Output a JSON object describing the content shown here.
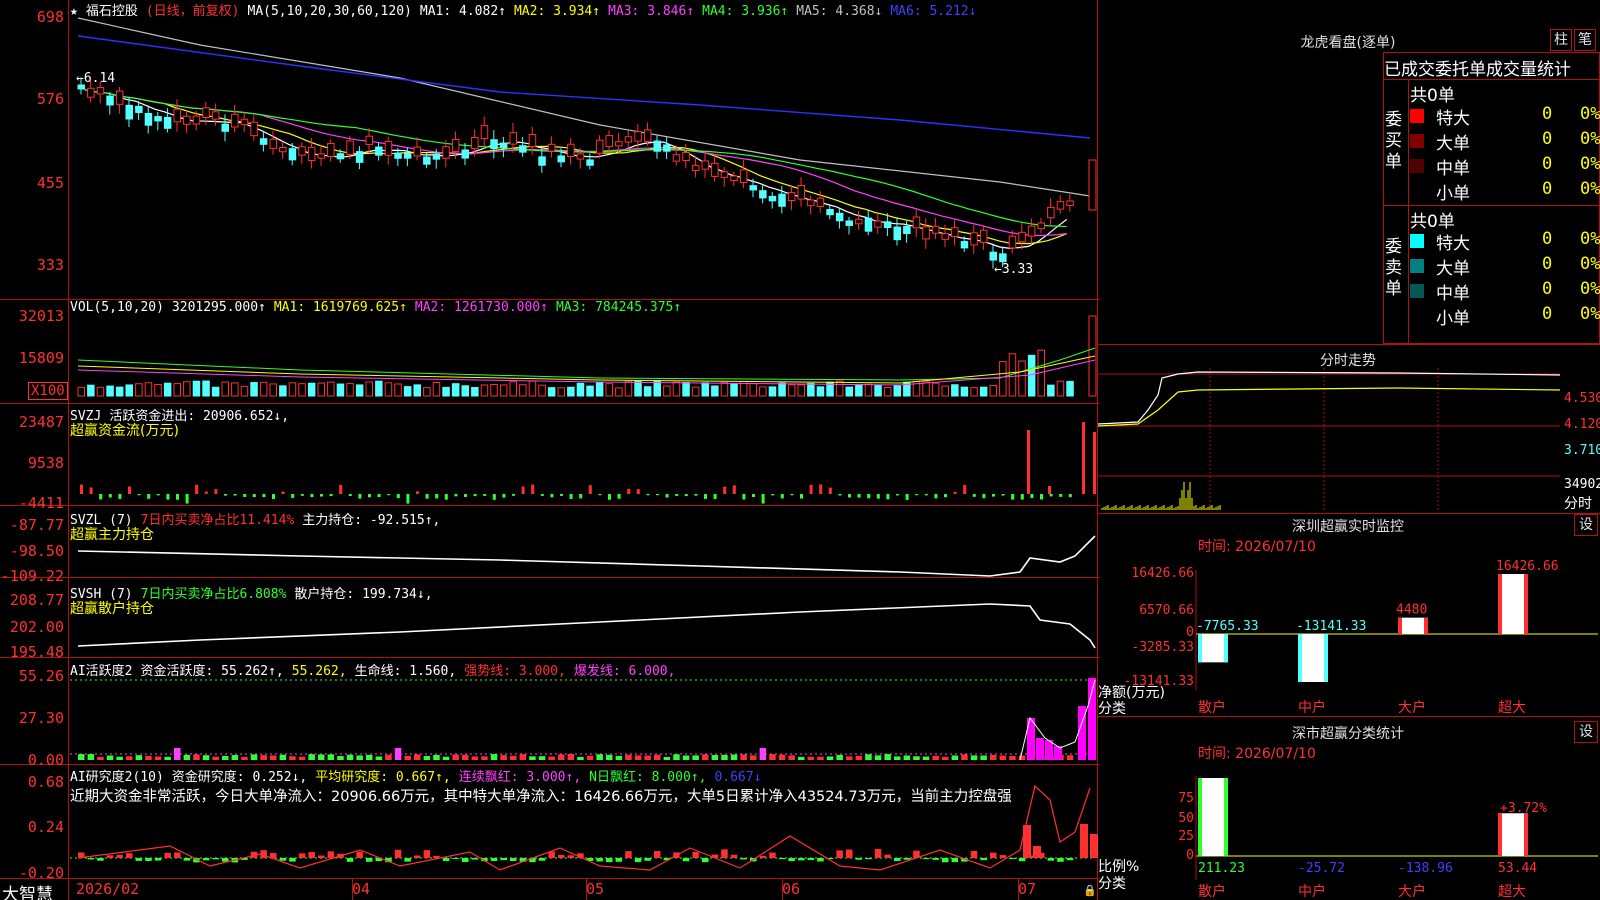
{
  "main": {
    "stock_name": "福石控股",
    "period": "(日线，前复权)",
    "ma_prefix": "MA(5,10,20,30,60,120)",
    "ma": [
      {
        "label": "MA1: 4.082↑",
        "color": "#ffffff"
      },
      {
        "label": "MA2: 3.934↑",
        "color": "#ffff00"
      },
      {
        "label": "MA3: 3.846↑",
        "color": "#ff40ff"
      },
      {
        "label": "MA4: 3.936↑",
        "color": "#30ff30"
      },
      {
        "label": "MA5: 4.368↓",
        "color": "#c0c0c0"
      },
      {
        "label": "MA6: 5.212↓",
        "color": "#4040ff"
      }
    ],
    "yticks": [
      "698",
      "576",
      "455",
      "333"
    ],
    "high_mark": "6.14",
    "low_mark": "3.33"
  },
  "volume": {
    "legend_prefix": "VOL(5,10,20)",
    "value": "3201295.000↑",
    "ma1": "MA1: 1619769.625↑",
    "ma2": "MA2: 1261730.000↑",
    "ma3": "MA3: 784245.375↑",
    "yticks": [
      "32013",
      "15809"
    ],
    "unit": "X100"
  },
  "svzj": {
    "name": "SVZJ",
    "line": "活跃资金进出: 20906.652↓,",
    "sub": "超赢资金流(万元)",
    "yticks": [
      "23487",
      "9538",
      "-4411"
    ]
  },
  "svzl": {
    "name": "SVZL (7)",
    "ratio": "7日内买卖净占比11.414%",
    "line": "主力持仓: -92.515↑,",
    "sub": "超赢主力持仓",
    "yticks": [
      "-87.77",
      "-98.50",
      "-109.22"
    ]
  },
  "svsh": {
    "name": "SVSH (7)",
    "ratio": "7日内买卖净占比6.808%",
    "line": "散户持仓: 199.734↓,",
    "sub": "超赢散户持仓",
    "yticks": [
      "208.77",
      "202.00",
      "195.48"
    ]
  },
  "ai_active": {
    "name": "AI活跃度2",
    "a": "资金活跃度: 55.262↑,",
    "b": "55.262,",
    "c": "生命线: 1.560,",
    "d": "强势线: 3.000,",
    "e": "爆发线: 6.000,",
    "yticks": [
      "55.26",
      "27.30",
      "0.00"
    ]
  },
  "ai_research": {
    "name": "AI研究度2(10)",
    "a": "资金研究度: 0.252↓,",
    "b": "平均研究度: 0.667↑,",
    "c": "连续飘红: 3.000↑,",
    "d": "N日飘红: 8.000↑,",
    "e": "0.667↓",
    "summary": "近期大资金非常活跃，今日大单净流入：20906.66万元，其中特大单净流入：16426.66万元，大单5日累计净入43524.73万元，当前主力控盘强",
    "yticks": [
      "0.68",
      "0.24",
      "-0.20"
    ]
  },
  "xaxis": {
    "brand": "大智慧",
    "ticks": [
      "2026/02",
      "04",
      "05",
      "06",
      "07"
    ]
  },
  "right": {
    "lhb_title": "龙虎看盘(逐单)",
    "btn_bar": "柱",
    "btn_pen": "笔",
    "stats_title": "已成交委托单成交量统计",
    "buy_label": "委买单",
    "sell_label": "委卖单",
    "buy_total": "共0单",
    "sell_total": "共0单",
    "buy_rows": [
      {
        "name": "特大",
        "n": "0",
        "p": "0%",
        "color": "#ff0000"
      },
      {
        "name": "大单",
        "n": "0",
        "p": "0%",
        "color": "#800000"
      },
      {
        "name": "中单",
        "n": "0",
        "p": "0%",
        "color": "#500000"
      },
      {
        "name": "小单",
        "n": "0",
        "p": "0%",
        "color": ""
      }
    ],
    "sell_rows": [
      {
        "name": "特大",
        "n": "0",
        "p": "0%",
        "color": "#00ffff"
      },
      {
        "name": "大单",
        "n": "0",
        "p": "0%",
        "color": "#008080"
      },
      {
        "name": "中单",
        "n": "0",
        "p": "0%",
        "color": "#005858"
      },
      {
        "name": "小单",
        "n": "0",
        "p": "0%",
        "color": ""
      }
    ],
    "intraday_title": "分时走势",
    "intraday_yticks": [
      "4.530",
      "4.120",
      "3.710"
    ],
    "intraday_vol": "34902",
    "intraday_label": "分时",
    "monitor_title": "深圳超赢实时监控",
    "monitor_btn": "设",
    "monitor_time": "时间: 2026/07/10",
    "monitor_yticks": [
      "16426.66",
      "6570.66",
      "0",
      "-3285.33",
      "-13141.33"
    ],
    "monitor_axis_label": "净额(万元)",
    "monitor_axis_label2": "分类",
    "monitor_cats": [
      "散户",
      "中户",
      "大户",
      "超大"
    ],
    "classify_title": "深市超赢分类统计",
    "classify_btn": "设",
    "classify_time": "时间: 2026/07/10",
    "classify_yticks": [
      "75",
      "50",
      "25",
      "0"
    ],
    "classify_axis_label": "比例%",
    "classify_axis_label2": "分类",
    "classify_pct_label": "+3.72%",
    "classify_cats": [
      "散户",
      "中户",
      "大户",
      "超大"
    ]
  },
  "chart_data": [
    {
      "type": "bar",
      "title": "深圳超赢实时监控",
      "ylabel": "净额(万元)",
      "categories": [
        "散户",
        "中户",
        "大户",
        "超大"
      ],
      "values": [
        -7765.33,
        -13141.33,
        4480,
        16426.66
      ],
      "ylim": [
        -13141.33,
        16426.66
      ]
    },
    {
      "type": "bar",
      "title": "深市超赢分类统计",
      "ylabel": "比例%",
      "categories": [
        "散户",
        "中户",
        "大户",
        "超大"
      ],
      "values": [
        211.23,
        -25.72,
        -138.96,
        53.44
      ],
      "ylim": [
        0,
        75
      ]
    }
  ]
}
